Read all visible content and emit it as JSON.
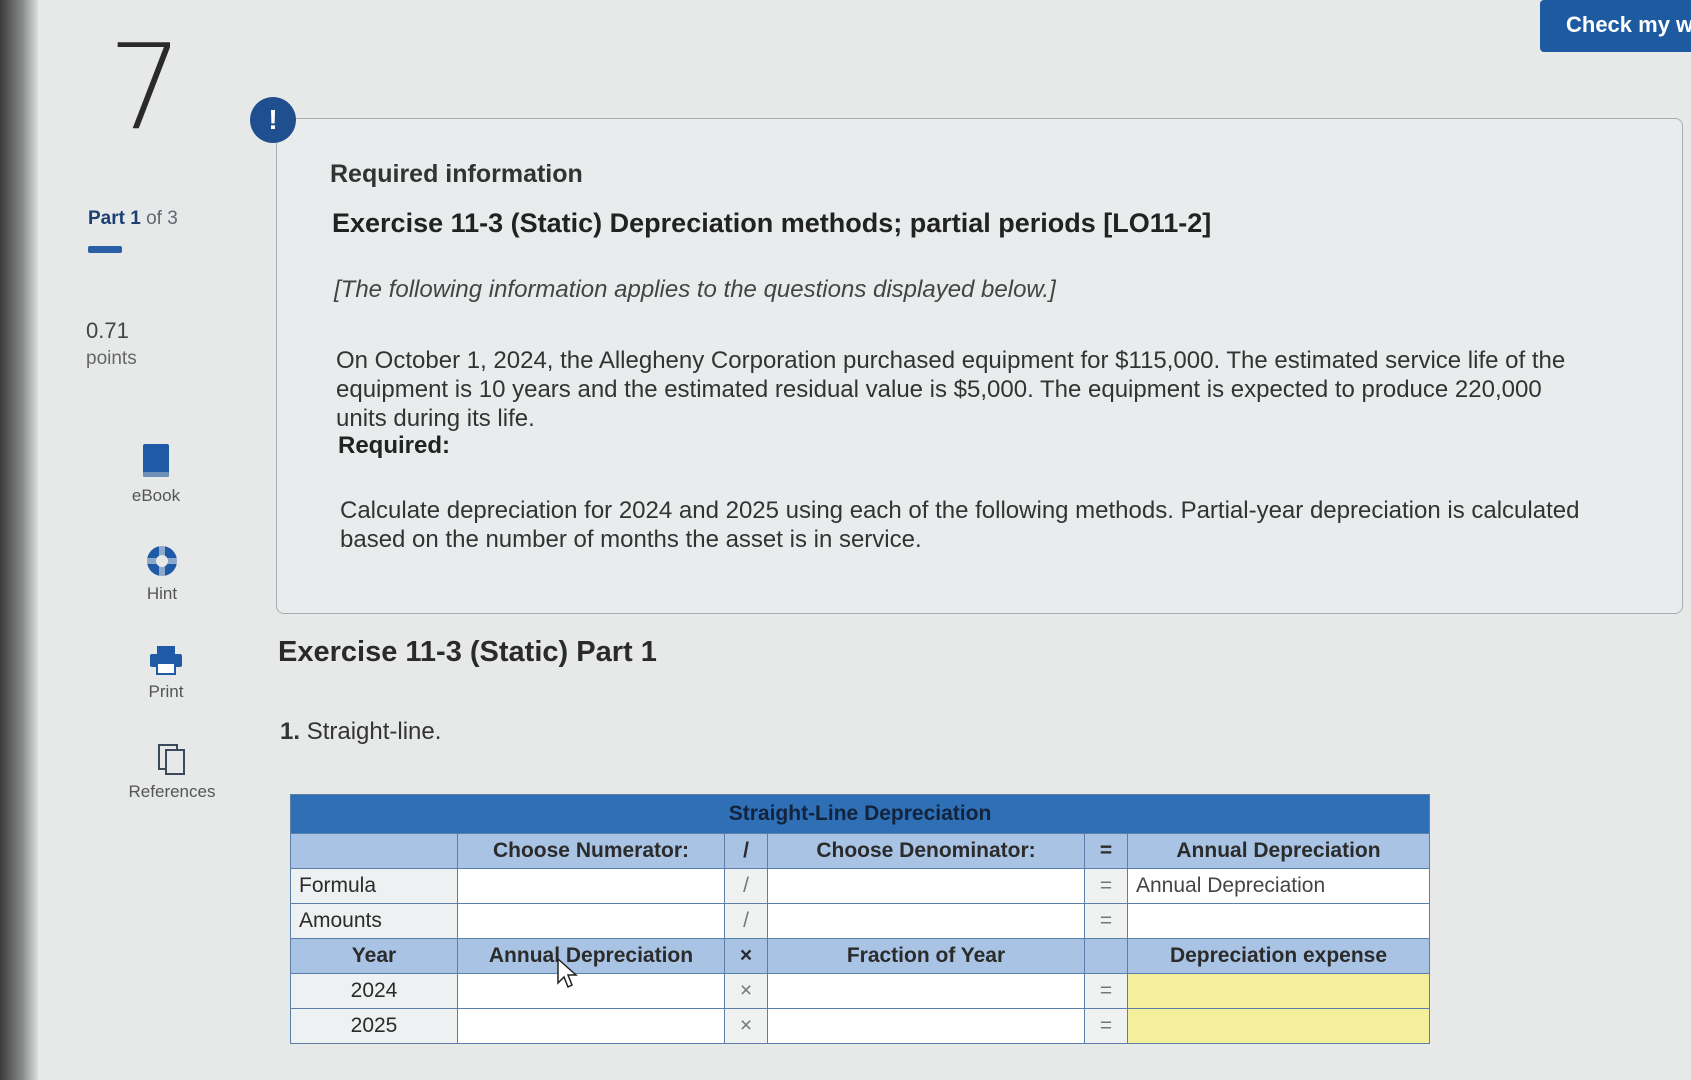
{
  "question": {
    "number": "7"
  },
  "part": {
    "label": "Part",
    "current": "1",
    "of_text": "of 3"
  },
  "points": {
    "value": "0.71",
    "label": "points"
  },
  "tools": [
    {
      "label": "eBook",
      "icon": "book-icon"
    },
    {
      "label": "Hint",
      "icon": "lifebuoy-icon"
    },
    {
      "label": "Print",
      "icon": "printer-icon"
    },
    {
      "label": "References",
      "icon": "copy-icon"
    }
  ],
  "header": {
    "check_button": "Check my w"
  },
  "alert": {
    "symbol": "!"
  },
  "info": {
    "required_title": "Required information",
    "exercise_title": "Exercise 11-3 (Static) Depreciation methods; partial periods [LO11-2]",
    "note": "[The following information applies to the questions displayed below.]",
    "paragraph": "On October 1, 2024, the Allegheny Corporation purchased equipment for $115,000. The estimated service life of the equipment is 10 years and the estimated residual value is $5,000. The equipment is expected to produce 220,000 units during its life.",
    "required_label": "Required:",
    "instruction": "Calculate depreciation for 2024 and 2025 using each of the following methods. Partial-year depreciation is calculated based on the number of months the asset is in service."
  },
  "part1": {
    "title": "Exercise 11-3 (Static) Part 1",
    "method_number": "1.",
    "method_name": "Straight-line."
  },
  "table": {
    "title": "Straight-Line Depreciation",
    "numerator_header": "Choose Numerator:",
    "divide_symbol": "/",
    "denominator_header": "Choose Denominator:",
    "equals_symbol": "=",
    "result_header": "Annual Depreciation",
    "formula_label": "Formula",
    "formula_result": "Annual Depreciation",
    "amounts_label": "Amounts",
    "year_header": "Year",
    "annual_dep_header": "Annual Depreciation",
    "times_symbol": "×",
    "fraction_header": "Fraction of Year",
    "expense_header": "Depreciation expense",
    "years": [
      "2024",
      "2025"
    ]
  },
  "colors": {
    "accent": "#1e5aa0",
    "table_header": "#2f6fb6",
    "table_sub": "#a8c3e3",
    "answer_yellow": "#f3ef9c"
  }
}
